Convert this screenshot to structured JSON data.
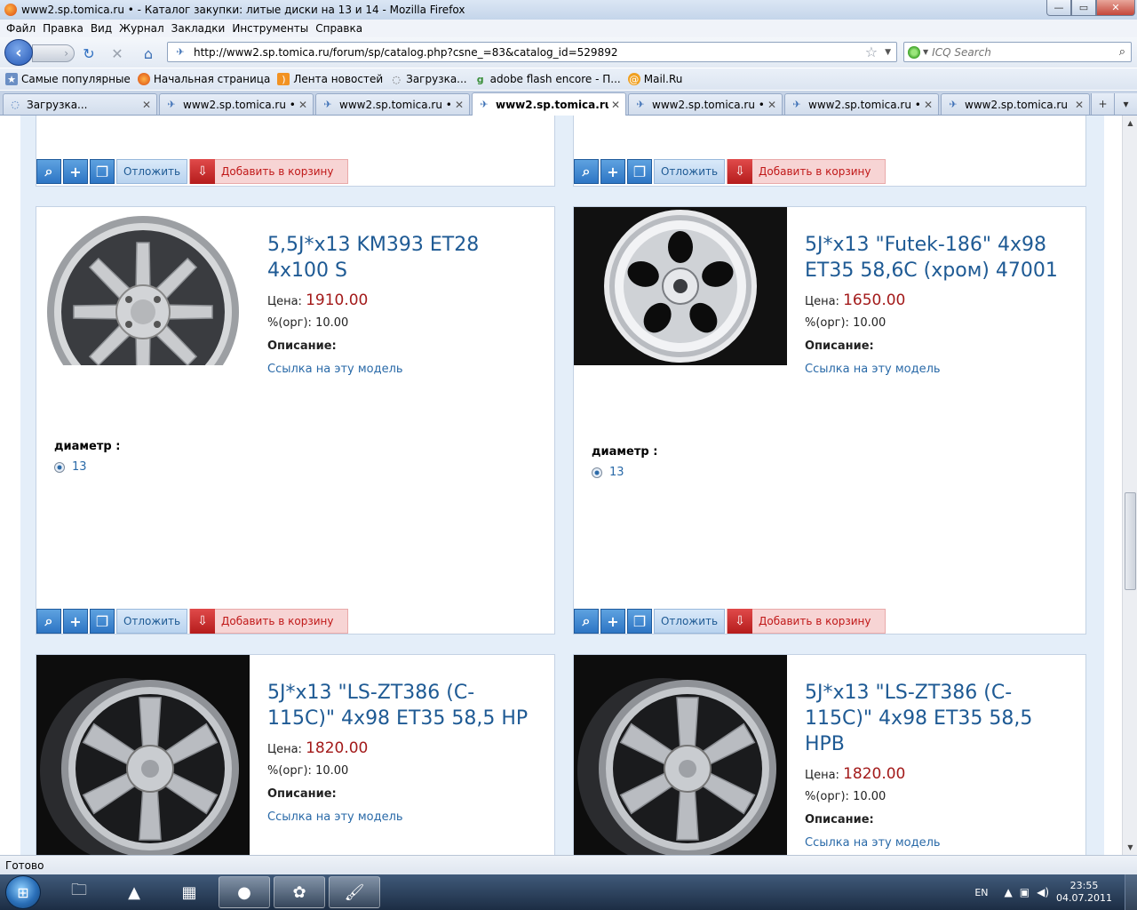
{
  "window": {
    "title": "www2.sp.tomica.ru • - Каталог закупки: литые диски на 13 и 14 - Mozilla Firefox",
    "controls": {
      "minimize": "—",
      "maximize": "▭",
      "close": "✕"
    }
  },
  "menu": [
    "Файл",
    "Правка",
    "Вид",
    "Журнал",
    "Закладки",
    "Инструменты",
    "Справка"
  ],
  "nav": {
    "back": "‹",
    "forward": "›",
    "url": "http://www2.sp.tomica.ru/forum/sp/catalog.php?csne_=83&catalog_id=529892",
    "search_placeholder": "ICQ Search"
  },
  "bookmarks": [
    {
      "label": "Самые популярные",
      "icon": "bookmark-icon"
    },
    {
      "label": "Начальная страница",
      "icon": "firefox-icon"
    },
    {
      "label": "Лента новостей",
      "icon": "rss-icon"
    },
    {
      "label": "Загрузка...",
      "icon": "loading-icon"
    },
    {
      "label": "adobe flash encore - П...",
      "icon": "google-icon"
    },
    {
      "label": "Mail.Ru",
      "icon": "mailru-icon"
    }
  ],
  "tabs": [
    {
      "label": "Загрузка...",
      "active": false
    },
    {
      "label": "www2.sp.tomica.ru • ...",
      "active": false
    },
    {
      "label": "www2.sp.tomica.ru • ...",
      "active": false
    },
    {
      "label": "www2.sp.tomica.ru ...",
      "active": true
    },
    {
      "label": "www2.sp.tomica.ru • ...",
      "active": false
    },
    {
      "label": "www2.sp.tomica.ru • ...",
      "active": false
    },
    {
      "label": "www2.sp.tomica.ru • ...",
      "active": false
    }
  ],
  "toolbar_labels": {
    "postpone": "Отложить",
    "add_to_cart": "Добавить в корзину"
  },
  "labels": {
    "price": "Цена:",
    "org": "%(орг):",
    "description": "Описание:",
    "link": "Ссылка на эту модель",
    "diameter": "диаметр :"
  },
  "products": [
    {
      "name": "5,5J*x13 KM393 ET28 4x100 S",
      "price": "1910.00",
      "org": "10.00",
      "diameter": "13",
      "wheel_style": "silver-8-spoke"
    },
    {
      "name": "5J*x13 \"Futek-186\" 4x98 ET35 58,6C (хром) 47001",
      "price": "1650.00",
      "org": "10.00",
      "diameter": "13",
      "wheel_style": "chrome-5-hole"
    },
    {
      "name": "5J*x13 \"LS-ZT386 (C-115C)\" 4x98 ET35 58,5 HP",
      "price": "1820.00",
      "org": "10.00",
      "wheel_style": "silver-6-spoke"
    },
    {
      "name": "5J*x13 \"LS-ZT386 (C-115C)\" 4x98 ET35 58,5 HPB",
      "price": "1820.00",
      "org": "10.00",
      "wheel_style": "silver-6-spoke"
    }
  ],
  "status": "Готово",
  "taskbar": {
    "lang": "EN",
    "time": "23:55",
    "date": "04.07.2011"
  }
}
